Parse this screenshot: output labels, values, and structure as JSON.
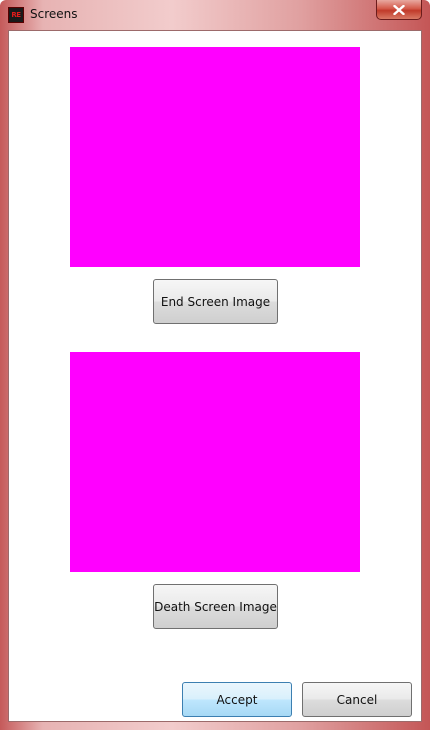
{
  "window": {
    "title": "Screens",
    "app_icon": "app-logo-icon",
    "app_icon_text": "RE",
    "close_icon": "close-icon"
  },
  "previews": {
    "end_color": "#ff00ff",
    "death_color": "#ff00ff"
  },
  "buttons": {
    "end_screen": "End Screen Image",
    "death_screen": "Death Screen Image",
    "accept": "Accept",
    "cancel": "Cancel"
  },
  "colors": {
    "frame_accent": "#c55a5a",
    "placeholder_magenta": "#ff00ff",
    "default_button_border": "#3c7fb1"
  }
}
